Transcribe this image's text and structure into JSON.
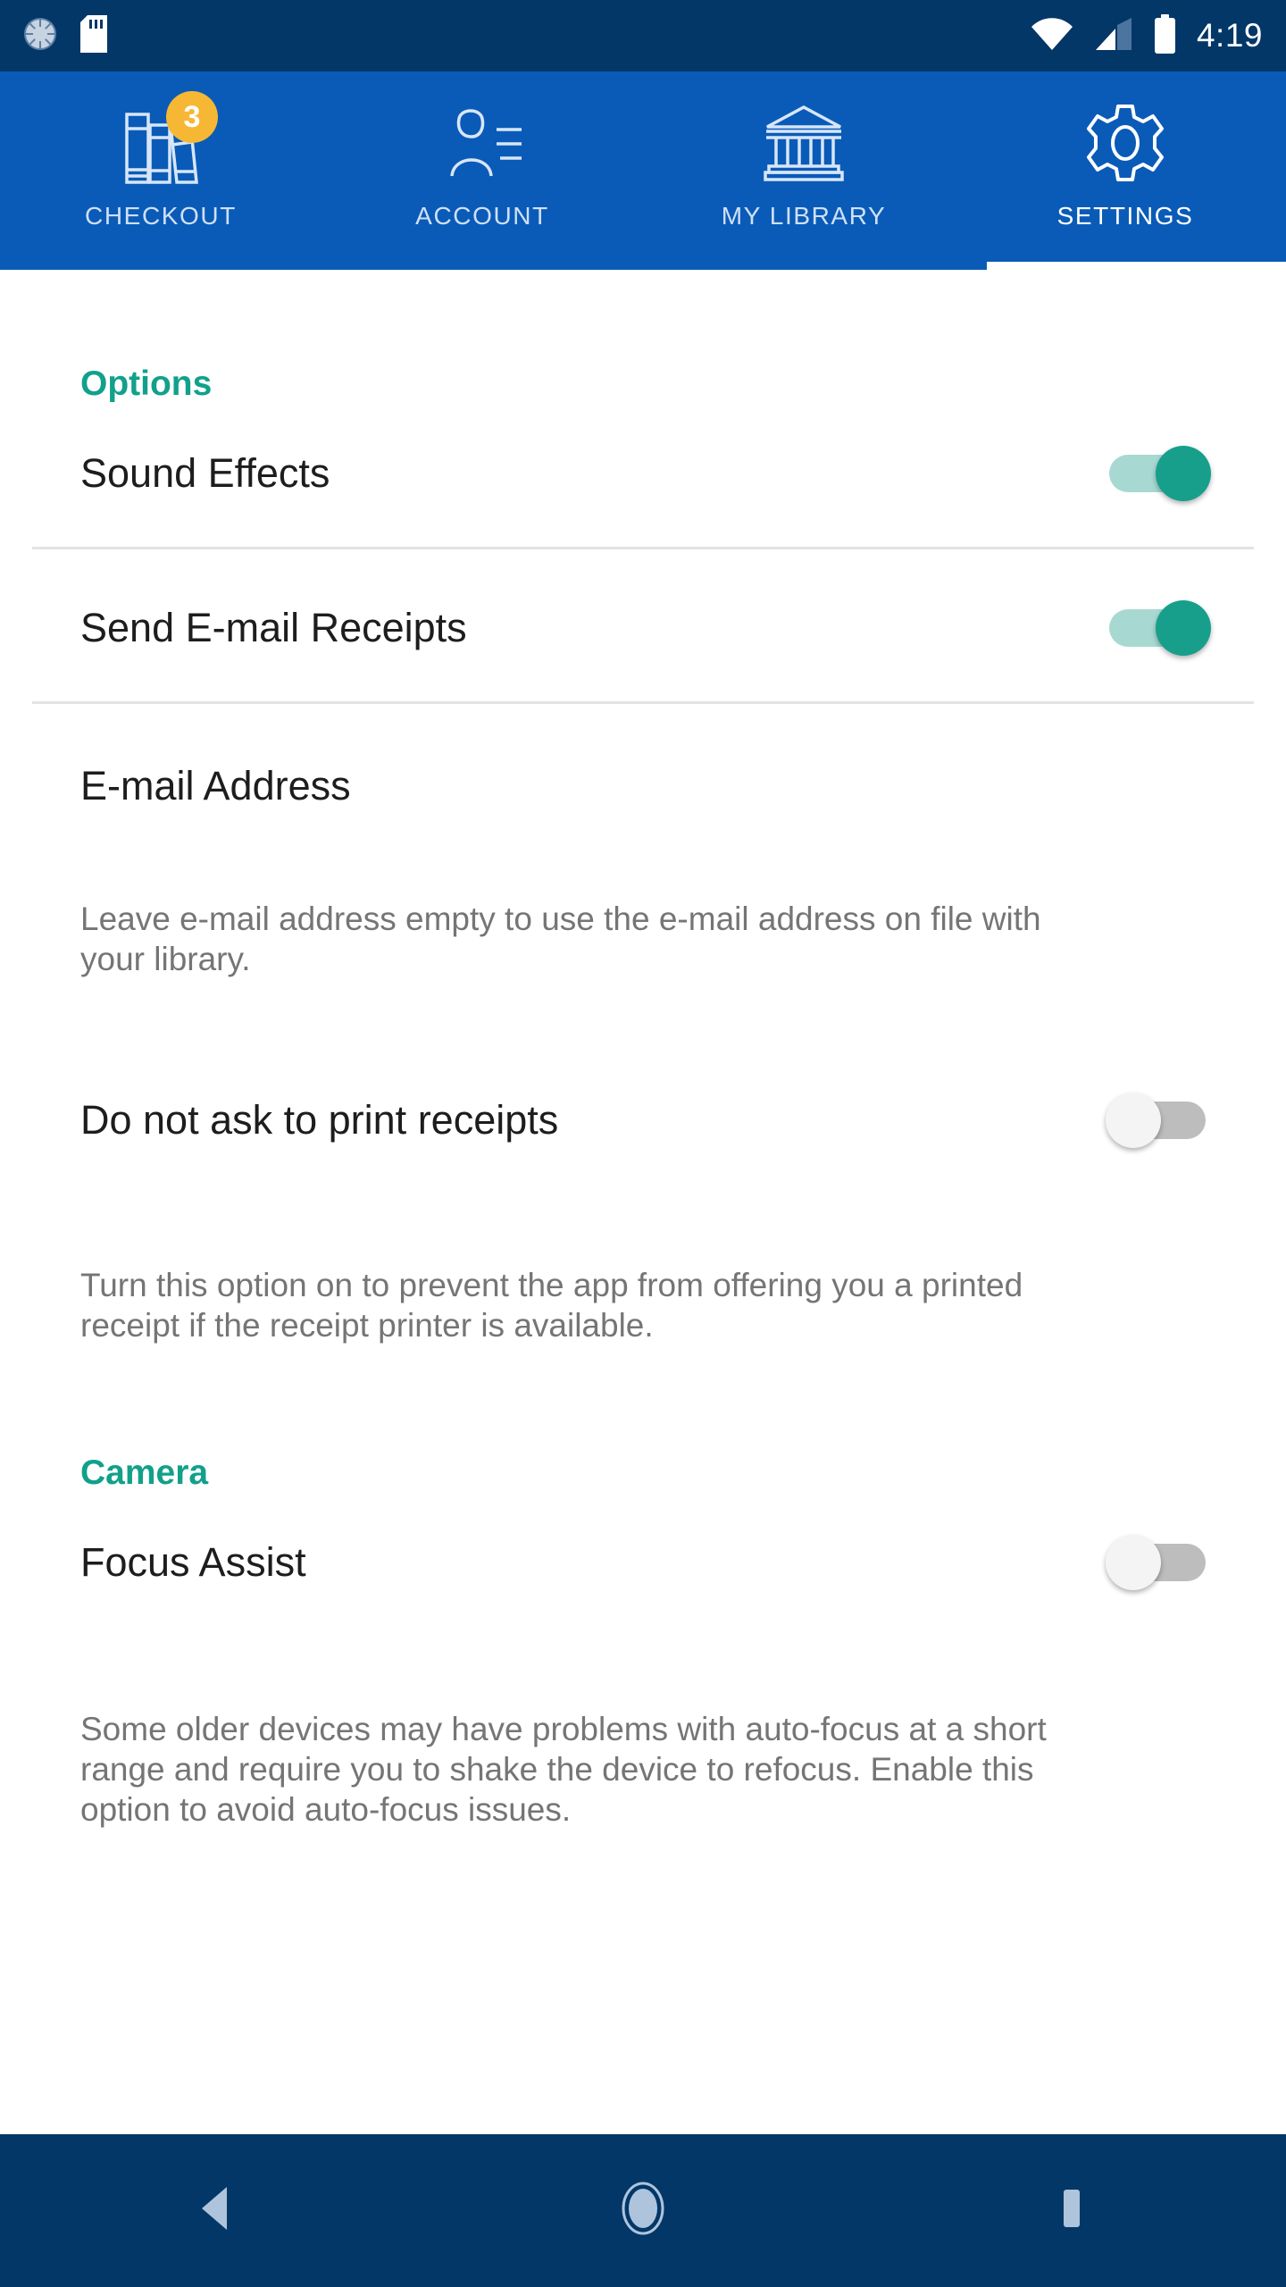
{
  "status_bar": {
    "time": "4:19",
    "icons": [
      "sync-spinner-icon",
      "sd-card-icon",
      "wifi-icon",
      "cellular-signal-icon",
      "battery-icon"
    ],
    "background_color": "#023767"
  },
  "tab_bar": {
    "background_color": "#0a5bb8",
    "active_indicator_color": "#ffffff",
    "tabs": [
      {
        "label": "CHECKOUT",
        "icon": "books-icon",
        "badge": "3",
        "badge_color": "#f6b834",
        "active": false
      },
      {
        "label": "ACCOUNT",
        "icon": "person-card-icon",
        "badge": null,
        "active": false
      },
      {
        "label": "MY LIBRARY",
        "icon": "library-building-icon",
        "badge": null,
        "active": false
      },
      {
        "label": "SETTINGS",
        "icon": "gear-icon",
        "badge": null,
        "active": true
      }
    ]
  },
  "settings": {
    "accent_color": "#12a08b",
    "sections": [
      {
        "header": "Options",
        "rows": {
          "sound_effects": {
            "label": "Sound Effects",
            "state": "on"
          },
          "send_email_receipts": {
            "label": "Send E-mail Receipts",
            "state": "on"
          },
          "email_address": {
            "placeholder": "E-mail Address",
            "value": ""
          },
          "email_help": "Leave e-mail address empty to use the e-mail address on file with your library.",
          "do_not_ask_print": {
            "label": "Do not ask to print receipts",
            "state": "off"
          },
          "print_help": "Turn this option on to prevent the app from offering you a printed receipt if the receipt printer is available."
        }
      },
      {
        "header": "Camera",
        "rows": {
          "focus_assist": {
            "label": "Focus Assist",
            "state": "off"
          },
          "focus_help": "Some older devices may have problems with auto-focus at a short range and require you to shake the device to refocus. Enable this option to avoid auto-focus issues."
        }
      }
    ]
  },
  "nav_bar": {
    "background_color": "#023767",
    "buttons": [
      {
        "name": "back-button",
        "icon": "back-triangle-icon"
      },
      {
        "name": "home-button",
        "icon": "home-circle-icon"
      },
      {
        "name": "recents-button",
        "icon": "recents-square-icon"
      }
    ]
  }
}
